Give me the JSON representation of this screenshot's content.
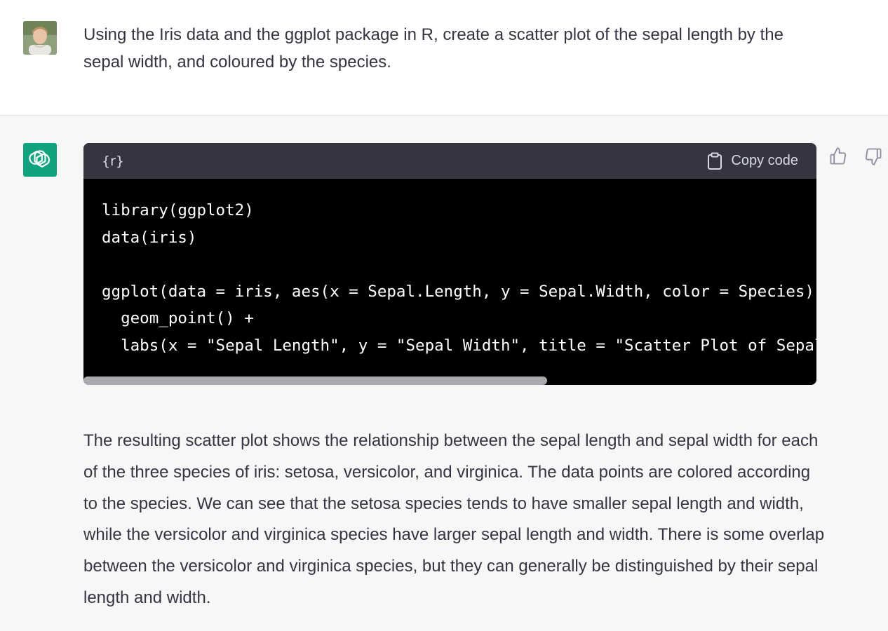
{
  "user_message": {
    "text": "Using the Iris data and the ggplot package in R, create a scatter plot of the sepal length by the sepal width, and coloured by the species.",
    "avatar_icon": "user-photo-avatar"
  },
  "assistant": {
    "avatar_icon": "openai-logo-icon",
    "avatar_color": "#10a37f",
    "code_block": {
      "language": "{r}",
      "copy_label": "Copy code",
      "lines": [
        "library(ggplot2)",
        "data(iris)",
        "",
        "ggplot(data = iris, aes(x = Sepal.Length, y = Sepal.Width, color = Species)) +",
        "  geom_point() +",
        "  labs(x = \"Sepal Length\", y = \"Sepal Width\", title = \"Scatter Plot of Sepal Length by Sepal Width\")"
      ]
    },
    "feedback": {
      "thumbs_up_icon": "thumbs-up-icon",
      "thumbs_down_icon": "thumbs-down-icon"
    },
    "response_text": "The resulting scatter plot shows the relationship between the sepal length and sepal width for each of the three species of iris: setosa, versicolor, and virginica. The data points are colored according to the species. We can see that the setosa species tends to have smaller sepal length and width, while the versicolor and virginica species have larger sepal length and width. There is some overlap between the versicolor and virginica species, but they can generally be distinguished by their sepal length and width."
  }
}
